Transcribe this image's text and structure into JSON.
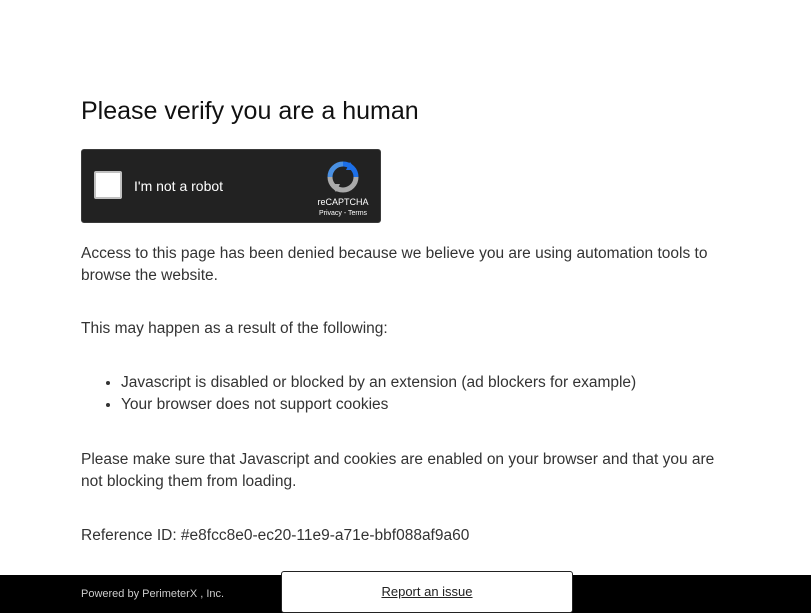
{
  "page": {
    "title": "Please verify you are a human"
  },
  "captcha": {
    "checkbox_label": "I'm not a robot",
    "brand": "reCAPTCHA",
    "privacy_link": "Privacy",
    "separator": " - ",
    "terms_link": "Terms",
    "logo_icon": "recaptcha-logo-icon"
  },
  "body": {
    "denied_message": "Access to this page has been denied because we believe you are using automation tools to browse the website.",
    "reasons_intro": "This may happen as a result of the following:",
    "reasons": [
      "Javascript is disabled or blocked by an extension (ad blockers for example)",
      "Your browser does not support cookies"
    ],
    "instructions": "Please make sure that Javascript and cookies are enabled on your browser and that you are not blocking them from loading.",
    "reference": "Reference ID: #e8fcc8e0-ec20-11e9-a71e-bbf088af9a60"
  },
  "footer": {
    "powered_by": "Powered by PerimeterX , Inc.",
    "report_label": "Report an issue"
  },
  "colors": {
    "captcha_bg": "#222222",
    "footer_bg": "#000000",
    "text": "#333333"
  }
}
